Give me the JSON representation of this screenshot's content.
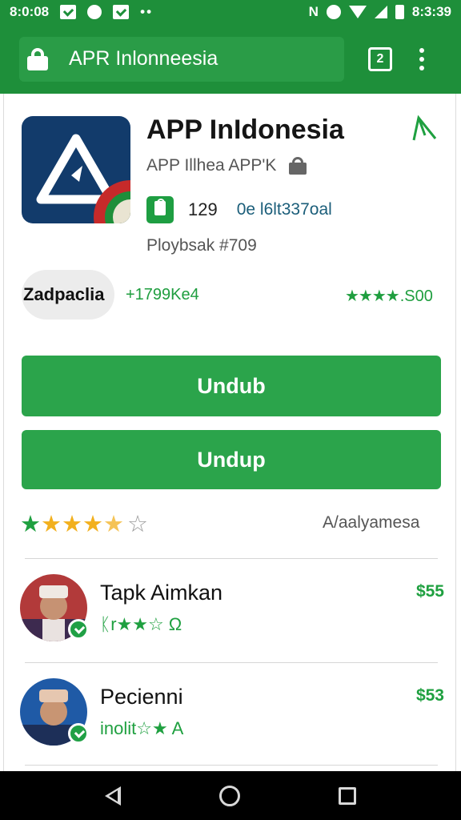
{
  "status_bar": {
    "time_left": "8:0:08",
    "time_right": "8:3:39",
    "nfc_label": "N",
    "icons": [
      "message-icon",
      "check-circle-icon",
      "mail-icon",
      "more-dots-icon",
      "nfc-icon",
      "alarm-icon",
      "wifi-icon",
      "signal-icon",
      "battery-icon"
    ]
  },
  "toolbar": {
    "url": "APR Inlonneesia",
    "tab_count": "2"
  },
  "app": {
    "title": "APP InIdonesia",
    "subtitle": "APP Illhea APP'K",
    "install_count": "129",
    "tag": "0e l6lt337oal",
    "playback": "Ploybsak  #709",
    "developer_chip": "Zadpaclia",
    "downloads_tag": "+1799Ke4",
    "rating_tag_stars": "★★★",
    "rating_tag_text": "★.S00"
  },
  "buttons": {
    "primary": "Undub",
    "secondary": "Undup"
  },
  "rating": {
    "value": 4.5,
    "max": 5,
    "caption": "A/aalyamesa"
  },
  "reviews": [
    {
      "name": "Tapk Aimkan",
      "stars_text": "ᛕr★★☆ Ω",
      "price": "$55"
    },
    {
      "name": "Pecienni",
      "stars_text": "inolit☆★ A",
      "price": "$53"
    }
  ],
  "colors": {
    "brand_green": "#1e8f3a",
    "button_green": "#2ba44b",
    "accent_green": "#1fa040",
    "star_gold": "#f2b01e",
    "app_icon_navy": "#123b6b"
  }
}
